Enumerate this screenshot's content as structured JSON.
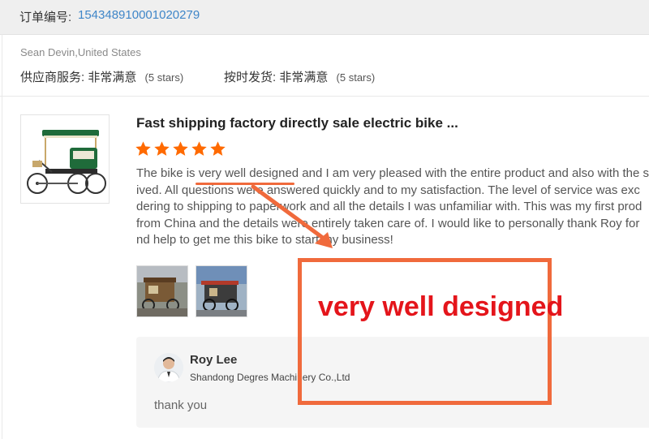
{
  "order": {
    "label": "订单编号:",
    "number": "154348910001020279"
  },
  "buyer": {
    "name": "Sean Devin,United States",
    "ratings": [
      {
        "label": "供应商服务:",
        "value": "非常满意",
        "stars": "(5 stars)"
      },
      {
        "label": "按时发货:",
        "value": "非常满意",
        "stars": "(5 stars)"
      }
    ]
  },
  "product": {
    "title": "Fast shipping factory directly sale electric bike ...",
    "rating": 5,
    "star_color": "#ff6a00"
  },
  "review": {
    "lines": [
      "The bike is very well designed and I am very pleased with the entire product and also with the s",
      "ived. All questions were answered quickly and to my satisfaction. The level of service was exc",
      "dering to shipping to paperwork and all the details I was unfamiliar with. This was my first prod",
      "from China and the details were entirely taken care of. I would like to personally thank Roy for",
      "nd help to get me this bike to start my business!"
    ]
  },
  "reply": {
    "name": "Roy Lee",
    "company": "Shandong Degres Machinery Co.,Ltd",
    "text": "thank you"
  },
  "annotation": {
    "label": "very well designed",
    "color": "#f06a3c",
    "text_color": "#e4151b"
  }
}
